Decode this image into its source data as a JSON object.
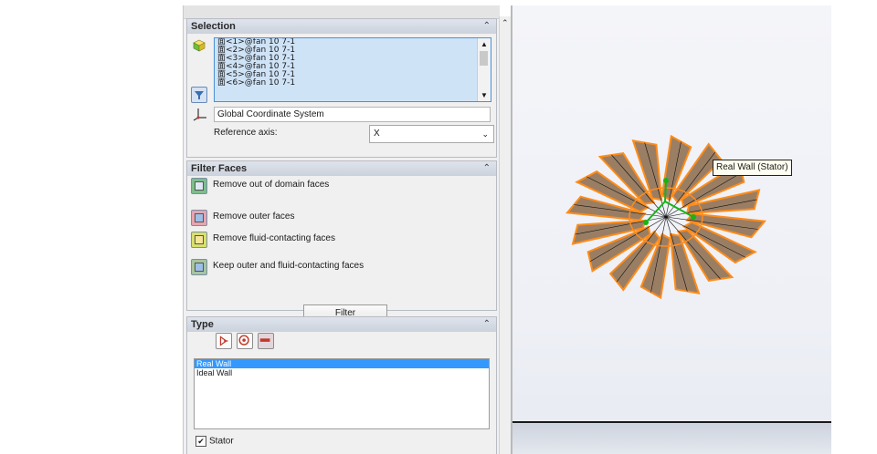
{
  "selection": {
    "title": "Selection",
    "items": [
      "面<1>@fan 10 7-1",
      "面<2>@fan 10 7-1",
      "面<3>@fan 10 7-1",
      "面<4>@fan 10 7-1",
      "面<5>@fan 10 7-1",
      "面<6>@fan 10 7-1"
    ],
    "coordinate_system": "Global Coordinate System",
    "reference_axis_label": "Reference axis:",
    "reference_axis_value": "X"
  },
  "filter_faces": {
    "title": "Filter Faces",
    "options": [
      "Remove out of domain faces",
      "Remove outer faces",
      "Remove fluid-contacting faces",
      "Keep outer and fluid-contacting faces"
    ],
    "filter_button": "Filter"
  },
  "type": {
    "title": "Type",
    "list": [
      "Real Wall",
      "Ideal Wall"
    ],
    "selected_index": 0,
    "stator_label": "Stator",
    "stator_checked": true
  },
  "viewport": {
    "tooltip": "Real Wall (Stator)"
  },
  "colors": {
    "blade_fill": "#8b6a4a",
    "blade_edge": "#ff8c1a",
    "axis_green": "#17b317",
    "selection_bg": "#cfe3f7",
    "selection_border": "#4a90d9",
    "list_highlight": "#3399ff"
  }
}
